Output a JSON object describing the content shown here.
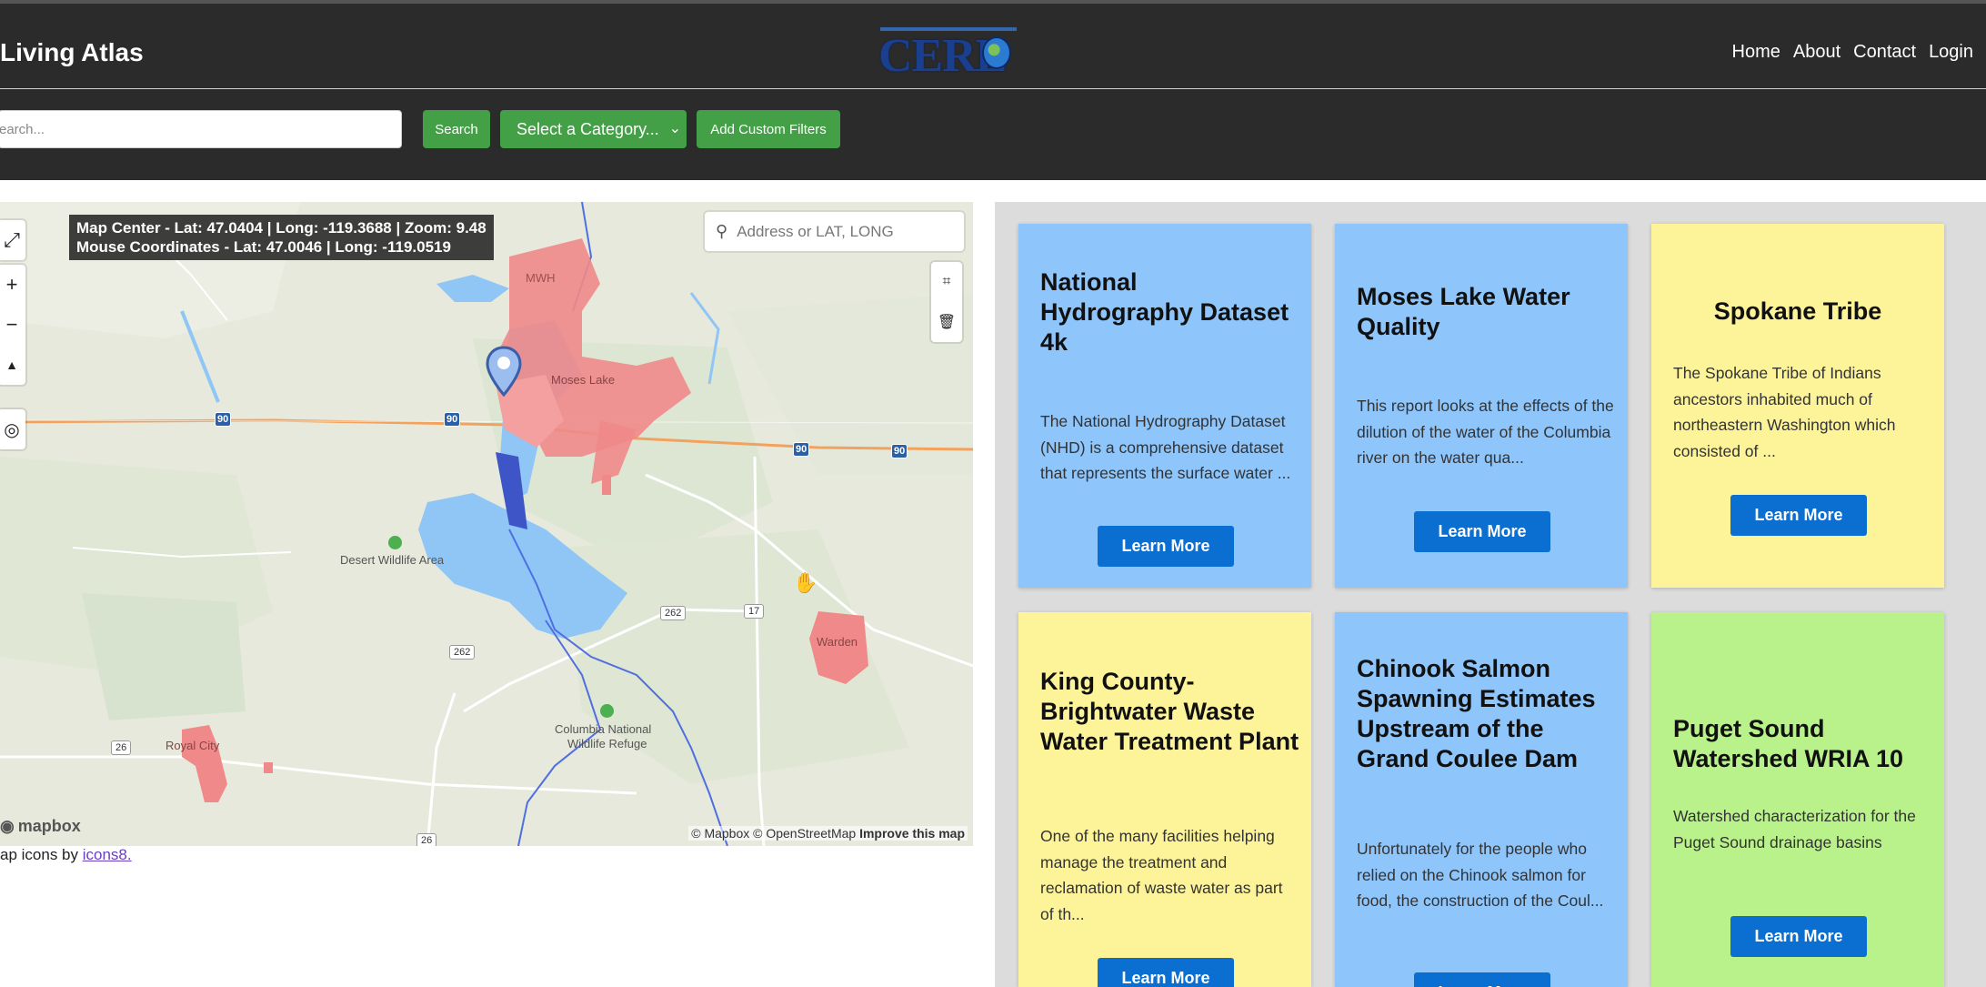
{
  "header": {
    "brand": "Living Atlas",
    "logo_text": "CERE",
    "nav": [
      "Home",
      "About",
      "Contact",
      "Login"
    ]
  },
  "toolbar": {
    "search_placeholder": "earch...",
    "search_label": "Search",
    "category_label": "Select a Category...",
    "custom_filters_label": "Add Custom Filters"
  },
  "map": {
    "coords_line1": "Map Center - Lat: 47.0404 | Long: -119.3688 | Zoom: 9.48",
    "coords_line2": "Mouse Coordinates - Lat: 47.0046 | Long: -119.0519",
    "geocoder_placeholder": "Address or LAT, LONG",
    "mapbox_logo": "mapbox",
    "attribution_1": "© Mapbox © OpenStreetMap",
    "attribution_2": "Improve this map",
    "labels": {
      "mwh": "MWH",
      "moses_lake": "Moses Lake",
      "desert_wildlife": "Desert Wildlife Area",
      "warden": "Warden",
      "columbia_refuge_1": "Columbia National",
      "columbia_refuge_2": "Wildlife Refuge",
      "royal_city": "Royal City"
    },
    "shields": {
      "i90_a": "90",
      "i90_b": "90",
      "i90_c": "90",
      "i90_d": "90",
      "sr262_a": "262",
      "sr262_b": "262",
      "sr17": "17",
      "sr26_a": "26",
      "sr26_b": "26"
    },
    "icons_credit_prefix": "ap icons by ",
    "icons_credit_link": "icons8."
  },
  "cards": [
    {
      "title": "National Hydrography Dataset 4k",
      "description": "The National Hydrography Dataset (NHD) is a comprehensive dataset that represents the surface water ...",
      "button": "Learn More",
      "color": "#8ec5fb"
    },
    {
      "title": "Moses Lake Water Quality",
      "description": "This report looks at the effects of the dilution of the water of the Columbia river on the water qua...",
      "button": "Learn More",
      "color": "#8ec5fb"
    },
    {
      "title": "Spokane Tribe",
      "description": "The Spokane Tribe of Indians ancestors inhabited much of northeastern Washington which consisted of ...",
      "button": "Learn More",
      "color": "#fdf49a"
    },
    {
      "title": "King County-Brightwater Waste Water Treatment Plant",
      "description": "One of the many facilities helping manage the treatment and reclamation of waste water as part of th...",
      "button": "Learn More",
      "color": "#fdf49a"
    },
    {
      "title": "Chinook Salmon Spawning Estimates Upstream of the Grand Coulee Dam",
      "description": "Unfortunately for the people who relied on the Chinook salmon for food, the construction of the Coul...",
      "button": "Learn More",
      "color": "#8ec5fb"
    },
    {
      "title": "Puget Sound Watershed WRIA 10",
      "description": "Watershed characterization for the Puget Sound drainage basins",
      "button": "Learn More",
      "color": "#b9f28a"
    }
  ]
}
